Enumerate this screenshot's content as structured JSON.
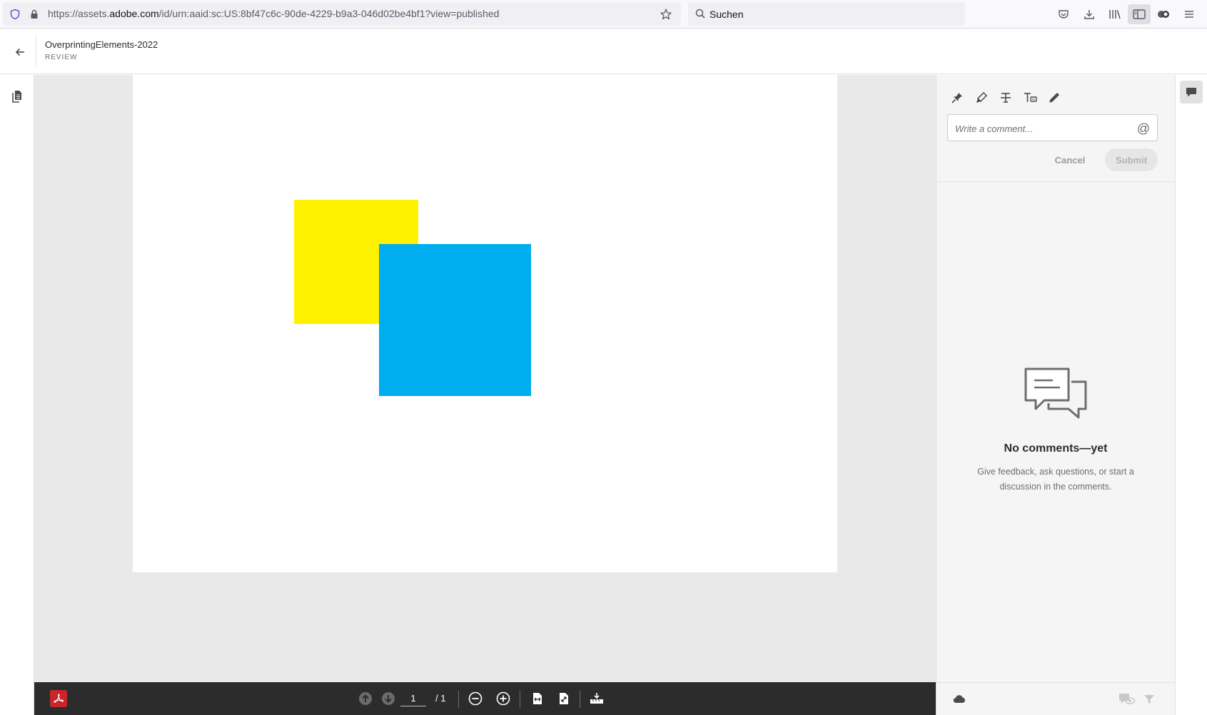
{
  "browser": {
    "url_prefix": "https://assets.",
    "url_host": "adobe.com",
    "url_path": "/id/urn:aaid:sc:US:8bf47c6c-90de-4229-b9a3-046d02be4bf1?view=published",
    "search_placeholder": "Suchen"
  },
  "header": {
    "title": "OverprintingElements-2022",
    "subtitle": "REVIEW"
  },
  "document": {
    "shapes": [
      {
        "name": "yellow-square",
        "color": "#fff200"
      },
      {
        "name": "cyan-square",
        "color": "#00aeef"
      }
    ]
  },
  "toolbar": {
    "current_page": "1",
    "total_pages": "/ 1"
  },
  "comments": {
    "placeholder": "Write a comment...",
    "at_symbol": "@",
    "cancel_label": "Cancel",
    "submit_label": "Submit",
    "empty_title": "No comments—yet",
    "empty_description": "Give feedback, ask questions, or start a discussion in the comments."
  },
  "colors": {
    "acrobat_red": "#c9252c",
    "toolbar_dark": "#2c2c2c",
    "canvas_gray": "#e9e9e9"
  }
}
